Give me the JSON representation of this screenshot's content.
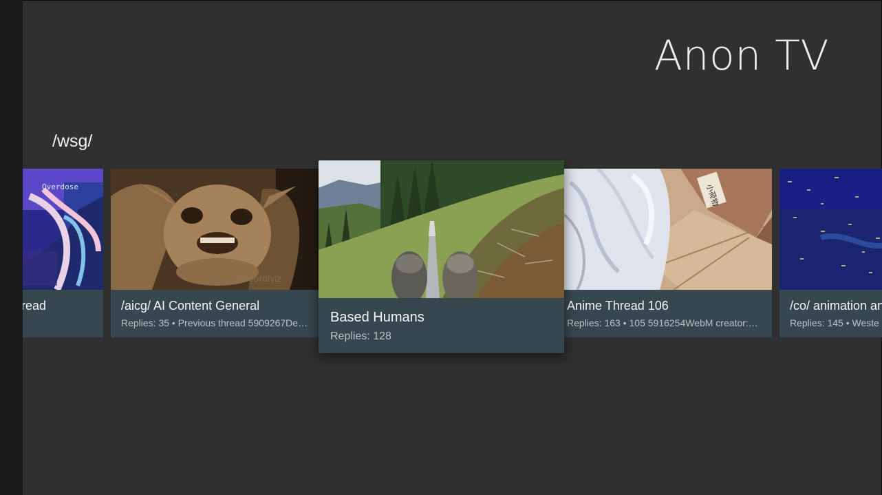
{
  "app": {
    "title": "Anon TV"
  },
  "row": {
    "header": "/wsg/"
  },
  "cards": [
    {
      "title": "/wsg/ Worksafe GIF Thread",
      "visible_title": "read",
      "subtitle": ""
    },
    {
      "title": "/aicg/ AI Content General",
      "subtitle": "Replies: 35 • Previous thread 5909267Ded…"
    },
    {
      "title": "Based Humans",
      "subtitle": "Replies: 128"
    },
    {
      "title": "Anime Thread 106",
      "subtitle": "Replies: 163 • 105 5916254WebM creator:…"
    },
    {
      "title": "/co/ animation an",
      "subtitle": "Replies: 145 • Weste"
    }
  ],
  "thumb_text": {
    "overdose": "Overdose",
    "watermark": "@neurolviz",
    "box_label": "小荷物"
  },
  "colors": {
    "background": "#303030",
    "card": "#37474f",
    "rail": "#1a1a1a"
  }
}
